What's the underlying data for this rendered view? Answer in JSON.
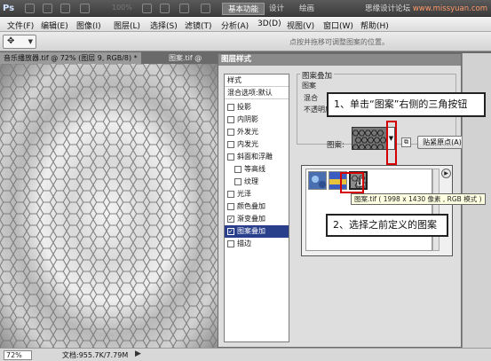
{
  "titlebar": {
    "logo": "Ps",
    "zoom_label": "100%",
    "workspaces": [
      "基本功能",
      "设计",
      "绘画"
    ],
    "active_workspace": "基本功能",
    "brand": "思缘设计论坛",
    "site": "www.missyuan.com"
  },
  "menubar": {
    "items": [
      "文件(F)",
      "编辑(E)",
      "图像(I)",
      "图层(L)",
      "选择(S)",
      "滤镜(T)",
      "分析(A)",
      "3D(D)",
      "视图(V)",
      "窗口(W)",
      "帮助(H)"
    ]
  },
  "options_bar": {
    "hint": "点按并拖移可调整图案的位置。"
  },
  "doc_tabs": [
    {
      "label": "音乐播放器.tif @ 72% (图层 9, RGB/8) *"
    },
    {
      "label": "图案.tif @"
    }
  ],
  "status_bar": {
    "zoom": "72%",
    "doc_info": "文档:955.7K/7.79M"
  },
  "dialog": {
    "title": "图层样式",
    "styles_header": "样式",
    "blend_options": "混合选项:默认",
    "effects": [
      {
        "label": "投影",
        "checked": false,
        "sub": false,
        "selected": false
      },
      {
        "label": "内阴影",
        "checked": false,
        "sub": false,
        "selected": false
      },
      {
        "label": "外发光",
        "checked": false,
        "sub": false,
        "selected": false
      },
      {
        "label": "内发光",
        "checked": false,
        "sub": false,
        "selected": false
      },
      {
        "label": "斜面和浮雕",
        "checked": false,
        "sub": false,
        "selected": false
      },
      {
        "label": "等高线",
        "checked": false,
        "sub": true,
        "selected": false
      },
      {
        "label": "纹理",
        "checked": false,
        "sub": true,
        "selected": false
      },
      {
        "label": "光泽",
        "checked": false,
        "sub": false,
        "selected": false
      },
      {
        "label": "颜色叠加",
        "checked": false,
        "sub": false,
        "selected": false
      },
      {
        "label": "渐变叠加",
        "checked": true,
        "sub": false,
        "selected": false
      },
      {
        "label": "图案叠加",
        "checked": true,
        "sub": false,
        "selected": true
      },
      {
        "label": "描边",
        "checked": false,
        "sub": false,
        "selected": false
      }
    ],
    "group_title": "图案叠加",
    "sub_group_title": "图案",
    "blend_label": "混合",
    "opacity_label": "不透明度",
    "pattern_label": "图案:",
    "snap_button": "贴紧原点(A)"
  },
  "picker": {
    "tooltip": "图案.tif ( 1998 x 1430 像素 , RGB 模式 )"
  },
  "annotations": {
    "step1": "1、单击“图案”右侧的三角按钮",
    "step2": "2、选择之前定义的图案"
  },
  "colors": {
    "highlight": "#d40000",
    "selected_row": "#2a3f8c",
    "tooltip_bg": "#ffffe1"
  }
}
